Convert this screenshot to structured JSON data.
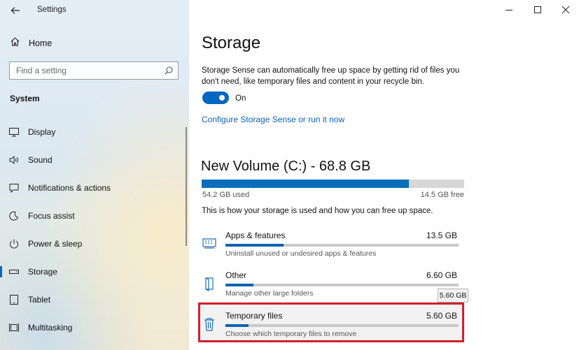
{
  "window": {
    "title": "Settings"
  },
  "sidebar": {
    "home_label": "Home",
    "search_placeholder": "Find a setting",
    "section_label": "System",
    "items": [
      {
        "label": "Display",
        "icon": "display-icon"
      },
      {
        "label": "Sound",
        "icon": "sound-icon"
      },
      {
        "label": "Notifications & actions",
        "icon": "notifications-icon"
      },
      {
        "label": "Focus assist",
        "icon": "focus-assist-icon"
      },
      {
        "label": "Power & sleep",
        "icon": "power-icon"
      },
      {
        "label": "Storage",
        "icon": "storage-icon",
        "active": true
      },
      {
        "label": "Tablet",
        "icon": "tablet-icon"
      },
      {
        "label": "Multitasking",
        "icon": "multitasking-icon"
      }
    ]
  },
  "main": {
    "title": "Storage",
    "description": "Storage Sense can automatically free up space by getting rid of files you don't need, like temporary files and content in your recycle bin.",
    "toggle_state": "On",
    "configure_link": "Configure Storage Sense or run it now",
    "volume": {
      "title": "New Volume (C:) - 68.8 GB",
      "used_label": "54.2 GB used",
      "free_label": "14.5 GB free",
      "used_fraction": 0.788
    },
    "usage_text": "This is how your storage is used and how you can free up space.",
    "categories": [
      {
        "name": "Apps & features",
        "size": "13.5 GB",
        "description": "Uninstall unused or undesired apps & features",
        "fraction": 0.25,
        "icon": "apps-icon"
      },
      {
        "name": "Other",
        "size": "6.60 GB",
        "description": "Manage other large folders",
        "fraction": 0.12,
        "icon": "folder-icon"
      },
      {
        "name": "Temporary files",
        "size": "5.60 GB",
        "description": "Choose which temporary files to remove",
        "fraction": 0.1,
        "icon": "trash-icon"
      }
    ],
    "tooltip": "5.60 GB"
  },
  "colors": {
    "accent": "#0067c0",
    "highlight": "#d0202c",
    "link": "#0a64b5"
  }
}
